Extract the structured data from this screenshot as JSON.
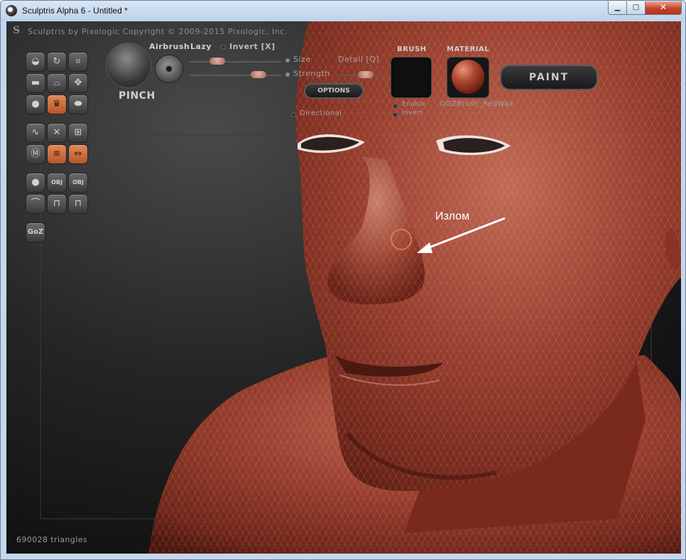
{
  "window": {
    "title": "Sculptris Alpha 6 - Untitled *",
    "min_glyph": "▁",
    "max_glyph": "□",
    "close_glyph": "✕"
  },
  "header": {
    "logo": "S",
    "text": "Sculptris by Pixologic    Copyright © 2009-2015 Pixologic, Inc."
  },
  "tool_row": {
    "tool_name": "PINCH",
    "airbrush": "Airbrush",
    "lazy": "Lazy",
    "invert": "Invert [X]",
    "size": "Size",
    "strength": "Strength",
    "detail": "Detail [Q]",
    "options": "OPTIONS",
    "directional": "Directional"
  },
  "brush": {
    "label": "BRUSH",
    "enable": "Enable",
    "invert": "Invert"
  },
  "material": {
    "label": "MATERIAL",
    "name": "OOZBrush_RedWax"
  },
  "paint_button": "PAINT",
  "toolbar_glyphs": {
    "goz": "GoZ",
    "obj": "OBJ"
  },
  "status": {
    "triangles": "690028 triangles"
  },
  "annotation": {
    "text": "Излом"
  },
  "colors": {
    "accent": "#c9672f",
    "mesh": "#9a3f2e",
    "background": "#1a1a1a"
  }
}
